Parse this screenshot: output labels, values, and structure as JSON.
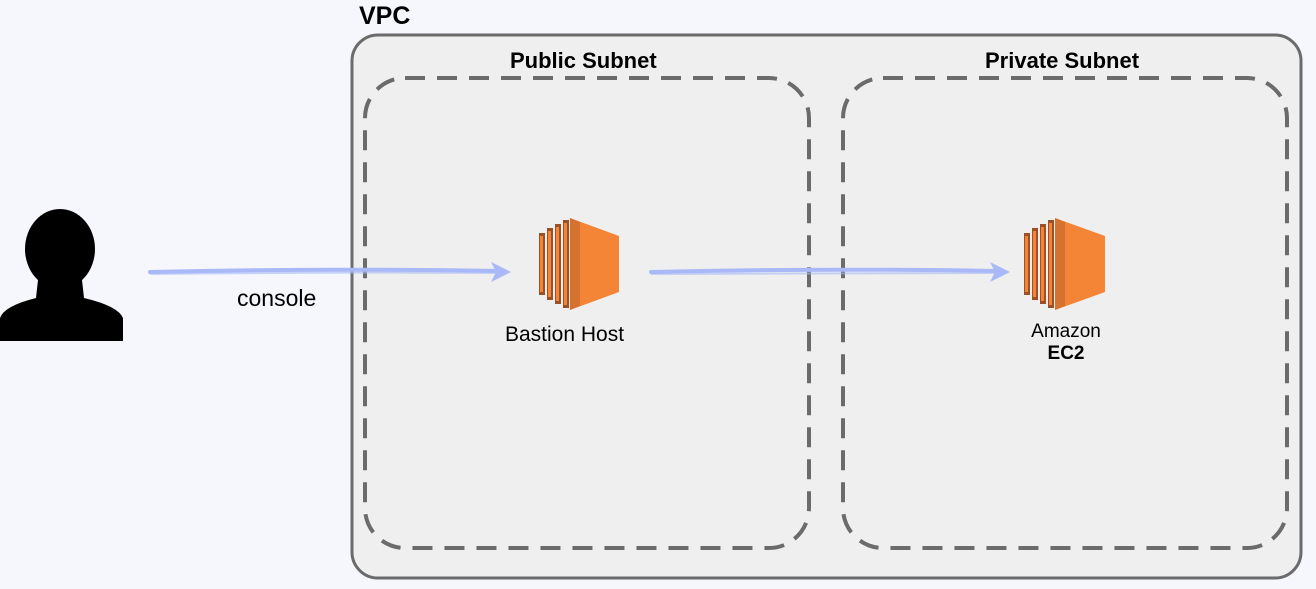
{
  "vpc": {
    "title": "VPC",
    "public_subnet": {
      "title": "Public Subnet",
      "bastion_host_label": "Bastion Host"
    },
    "private_subnet": {
      "title": "Private Subnet",
      "ec2_label_line1": "Amazon",
      "ec2_label_line2": "EC2"
    }
  },
  "user": {
    "connection_label": "console"
  },
  "colors": {
    "background": "#f5f7fd",
    "vpc_fill": "#efefef",
    "border": "#6b6b6b",
    "arrow": "#a9b9f7",
    "ec2_orange": "#f58536",
    "ec2_dark": "#9d5025",
    "user_icon": "#000000"
  },
  "icons": [
    "user-icon",
    "ec2-instance-icon"
  ]
}
